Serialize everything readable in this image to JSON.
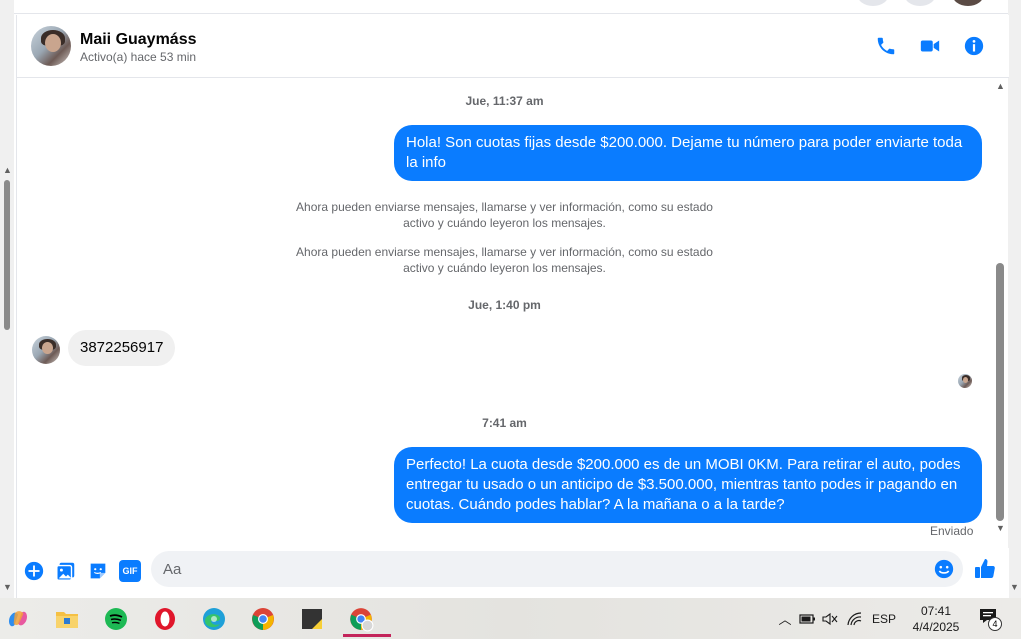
{
  "header": {
    "name": "Maii Guaymáss",
    "status": "Activo(a) hace 53 min"
  },
  "messages": {
    "ts1": "Jue, 11:37 am",
    "out1": "Hola! Son cuotas fijas desde $200.000. Dejame tu número para poder enviarte toda la info",
    "notice1": "Ahora pueden enviarse mensajes, llamarse y ver información, como su estado activo y cuándo leyeron los mensajes.",
    "notice2": "Ahora pueden enviarse mensajes, llamarse y ver información, como su estado activo y cuándo leyeron los mensajes.",
    "ts2": "Jue, 1:40 pm",
    "in1": "3872256917",
    "ts3": "7:41 am",
    "out2": "Perfecto! La cuota desde $200.000 es de un MOBI 0KM. Para retirar el auto, podes entregar tu usado o un anticipo de $3.500.000, mientras tanto podes ir pagando en cuotas. Cuándo podes hablar? A la mañana o a la tarde?",
    "sent_status": "Enviado"
  },
  "composer": {
    "placeholder": "Aa",
    "gif_label": "GIF"
  },
  "taskbar": {
    "language": "ESP",
    "time": "07:41",
    "date": "4/4/2025",
    "notification_count": "4"
  },
  "colors": {
    "accent": "#0a7cff",
    "incoming_bubble": "#f0f0f0",
    "muted_text": "#65676b"
  }
}
